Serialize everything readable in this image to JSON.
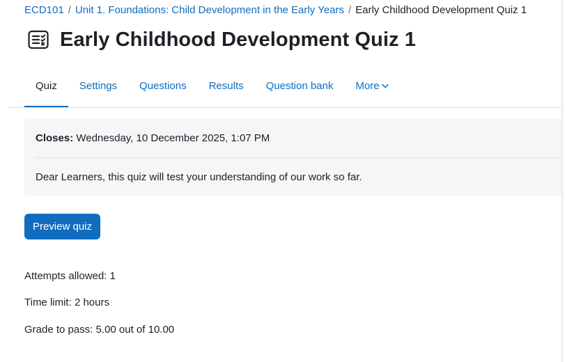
{
  "breadcrumb": {
    "course": "ECD101",
    "section": "Unit 1. Foundations: Child Development in the Early Years",
    "current": "Early Childhood Development Quiz 1",
    "separator": "/"
  },
  "header": {
    "icon": "quiz-icon",
    "title": "Early Childhood Development Quiz 1"
  },
  "tabs": [
    {
      "label": "Quiz",
      "active": true
    },
    {
      "label": "Settings",
      "active": false
    },
    {
      "label": "Questions",
      "active": false
    },
    {
      "label": "Results",
      "active": false
    },
    {
      "label": "Question bank",
      "active": false
    },
    {
      "label": "More",
      "active": false,
      "icon": "chevron-down-icon"
    }
  ],
  "activity": {
    "closes_label": "Closes:",
    "closes_value": "Wednesday, 10 December 2025, 1:07 PM",
    "description": "Dear Learners, this quiz will test your understanding of our work so far."
  },
  "actions": {
    "preview_label": "Preview quiz"
  },
  "quiz_info": {
    "attempts": "Attempts allowed: 1",
    "time_limit": "Time limit: 2 hours",
    "grade_to_pass": "Grade to pass: 5.00 out of 10.00"
  },
  "colors": {
    "link": "#0f6cbf",
    "text": "#1d2125",
    "panel_bg": "#f5f6f7",
    "button_bg": "#0f6cbf"
  }
}
